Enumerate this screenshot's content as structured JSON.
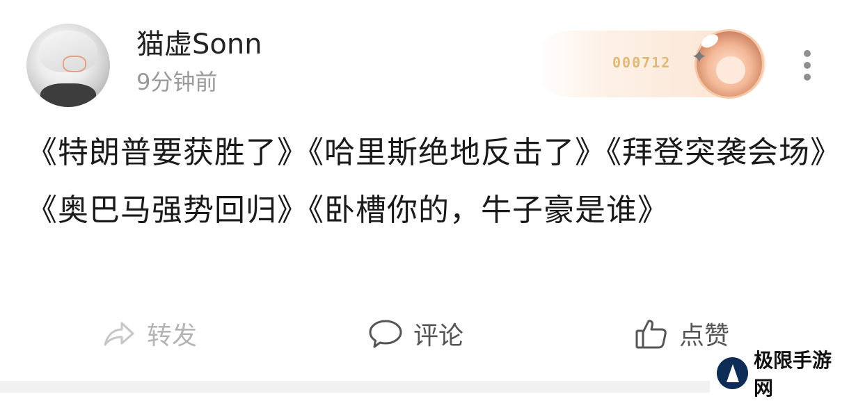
{
  "post": {
    "username": "猫虚Sonn",
    "timestamp": "9分钟前",
    "badge_number": "000712",
    "content": "《特朗普要获胜了》《哈里斯绝地反击了》《拜登突袭会场》《奥巴马强势回归》《卧槽你的，牛子豪是谁》"
  },
  "actions": {
    "share_label": "转发",
    "comment_label": "评论",
    "like_label": "点赞"
  },
  "icons": {
    "more": "more-vertical-icon",
    "share": "share-arrow-icon",
    "comment": "comment-bubble-icon",
    "like": "thumbs-up-icon"
  },
  "watermark": {
    "text": "极限手游网"
  },
  "colors": {
    "muted_gray": "#9a9a9a",
    "share_disabled": "#b4b4b4",
    "badge_gold": "#e0b878",
    "watermark_navy": "#0d2d57"
  }
}
